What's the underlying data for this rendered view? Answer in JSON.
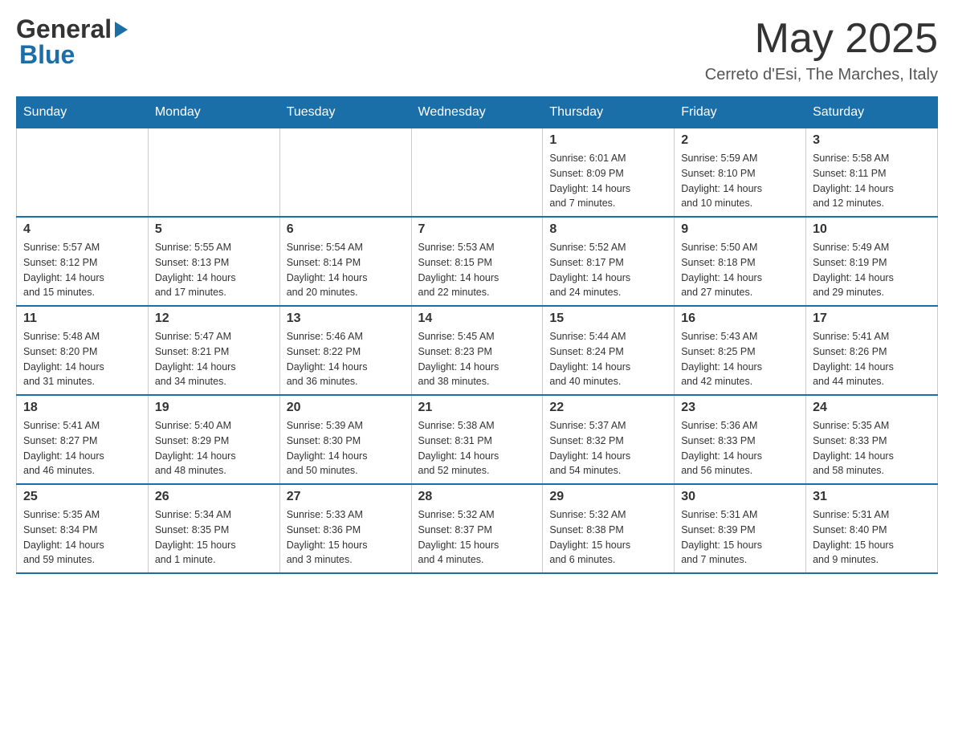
{
  "header": {
    "logo_general": "General",
    "logo_blue": "Blue",
    "title": "May 2025",
    "subtitle": "Cerreto d'Esi, The Marches, Italy"
  },
  "calendar": {
    "days_of_week": [
      "Sunday",
      "Monday",
      "Tuesday",
      "Wednesday",
      "Thursday",
      "Friday",
      "Saturday"
    ],
    "weeks": [
      [
        {
          "day": "",
          "info": ""
        },
        {
          "day": "",
          "info": ""
        },
        {
          "day": "",
          "info": ""
        },
        {
          "day": "",
          "info": ""
        },
        {
          "day": "1",
          "info": "Sunrise: 6:01 AM\nSunset: 8:09 PM\nDaylight: 14 hours\nand 7 minutes."
        },
        {
          "day": "2",
          "info": "Sunrise: 5:59 AM\nSunset: 8:10 PM\nDaylight: 14 hours\nand 10 minutes."
        },
        {
          "day": "3",
          "info": "Sunrise: 5:58 AM\nSunset: 8:11 PM\nDaylight: 14 hours\nand 12 minutes."
        }
      ],
      [
        {
          "day": "4",
          "info": "Sunrise: 5:57 AM\nSunset: 8:12 PM\nDaylight: 14 hours\nand 15 minutes."
        },
        {
          "day": "5",
          "info": "Sunrise: 5:55 AM\nSunset: 8:13 PM\nDaylight: 14 hours\nand 17 minutes."
        },
        {
          "day": "6",
          "info": "Sunrise: 5:54 AM\nSunset: 8:14 PM\nDaylight: 14 hours\nand 20 minutes."
        },
        {
          "day": "7",
          "info": "Sunrise: 5:53 AM\nSunset: 8:15 PM\nDaylight: 14 hours\nand 22 minutes."
        },
        {
          "day": "8",
          "info": "Sunrise: 5:52 AM\nSunset: 8:17 PM\nDaylight: 14 hours\nand 24 minutes."
        },
        {
          "day": "9",
          "info": "Sunrise: 5:50 AM\nSunset: 8:18 PM\nDaylight: 14 hours\nand 27 minutes."
        },
        {
          "day": "10",
          "info": "Sunrise: 5:49 AM\nSunset: 8:19 PM\nDaylight: 14 hours\nand 29 minutes."
        }
      ],
      [
        {
          "day": "11",
          "info": "Sunrise: 5:48 AM\nSunset: 8:20 PM\nDaylight: 14 hours\nand 31 minutes."
        },
        {
          "day": "12",
          "info": "Sunrise: 5:47 AM\nSunset: 8:21 PM\nDaylight: 14 hours\nand 34 minutes."
        },
        {
          "day": "13",
          "info": "Sunrise: 5:46 AM\nSunset: 8:22 PM\nDaylight: 14 hours\nand 36 minutes."
        },
        {
          "day": "14",
          "info": "Sunrise: 5:45 AM\nSunset: 8:23 PM\nDaylight: 14 hours\nand 38 minutes."
        },
        {
          "day": "15",
          "info": "Sunrise: 5:44 AM\nSunset: 8:24 PM\nDaylight: 14 hours\nand 40 minutes."
        },
        {
          "day": "16",
          "info": "Sunrise: 5:43 AM\nSunset: 8:25 PM\nDaylight: 14 hours\nand 42 minutes."
        },
        {
          "day": "17",
          "info": "Sunrise: 5:41 AM\nSunset: 8:26 PM\nDaylight: 14 hours\nand 44 minutes."
        }
      ],
      [
        {
          "day": "18",
          "info": "Sunrise: 5:41 AM\nSunset: 8:27 PM\nDaylight: 14 hours\nand 46 minutes."
        },
        {
          "day": "19",
          "info": "Sunrise: 5:40 AM\nSunset: 8:29 PM\nDaylight: 14 hours\nand 48 minutes."
        },
        {
          "day": "20",
          "info": "Sunrise: 5:39 AM\nSunset: 8:30 PM\nDaylight: 14 hours\nand 50 minutes."
        },
        {
          "day": "21",
          "info": "Sunrise: 5:38 AM\nSunset: 8:31 PM\nDaylight: 14 hours\nand 52 minutes."
        },
        {
          "day": "22",
          "info": "Sunrise: 5:37 AM\nSunset: 8:32 PM\nDaylight: 14 hours\nand 54 minutes."
        },
        {
          "day": "23",
          "info": "Sunrise: 5:36 AM\nSunset: 8:33 PM\nDaylight: 14 hours\nand 56 minutes."
        },
        {
          "day": "24",
          "info": "Sunrise: 5:35 AM\nSunset: 8:33 PM\nDaylight: 14 hours\nand 58 minutes."
        }
      ],
      [
        {
          "day": "25",
          "info": "Sunrise: 5:35 AM\nSunset: 8:34 PM\nDaylight: 14 hours\nand 59 minutes."
        },
        {
          "day": "26",
          "info": "Sunrise: 5:34 AM\nSunset: 8:35 PM\nDaylight: 15 hours\nand 1 minute."
        },
        {
          "day": "27",
          "info": "Sunrise: 5:33 AM\nSunset: 8:36 PM\nDaylight: 15 hours\nand 3 minutes."
        },
        {
          "day": "28",
          "info": "Sunrise: 5:32 AM\nSunset: 8:37 PM\nDaylight: 15 hours\nand 4 minutes."
        },
        {
          "day": "29",
          "info": "Sunrise: 5:32 AM\nSunset: 8:38 PM\nDaylight: 15 hours\nand 6 minutes."
        },
        {
          "day": "30",
          "info": "Sunrise: 5:31 AM\nSunset: 8:39 PM\nDaylight: 15 hours\nand 7 minutes."
        },
        {
          "day": "31",
          "info": "Sunrise: 5:31 AM\nSunset: 8:40 PM\nDaylight: 15 hours\nand 9 minutes."
        }
      ]
    ]
  }
}
